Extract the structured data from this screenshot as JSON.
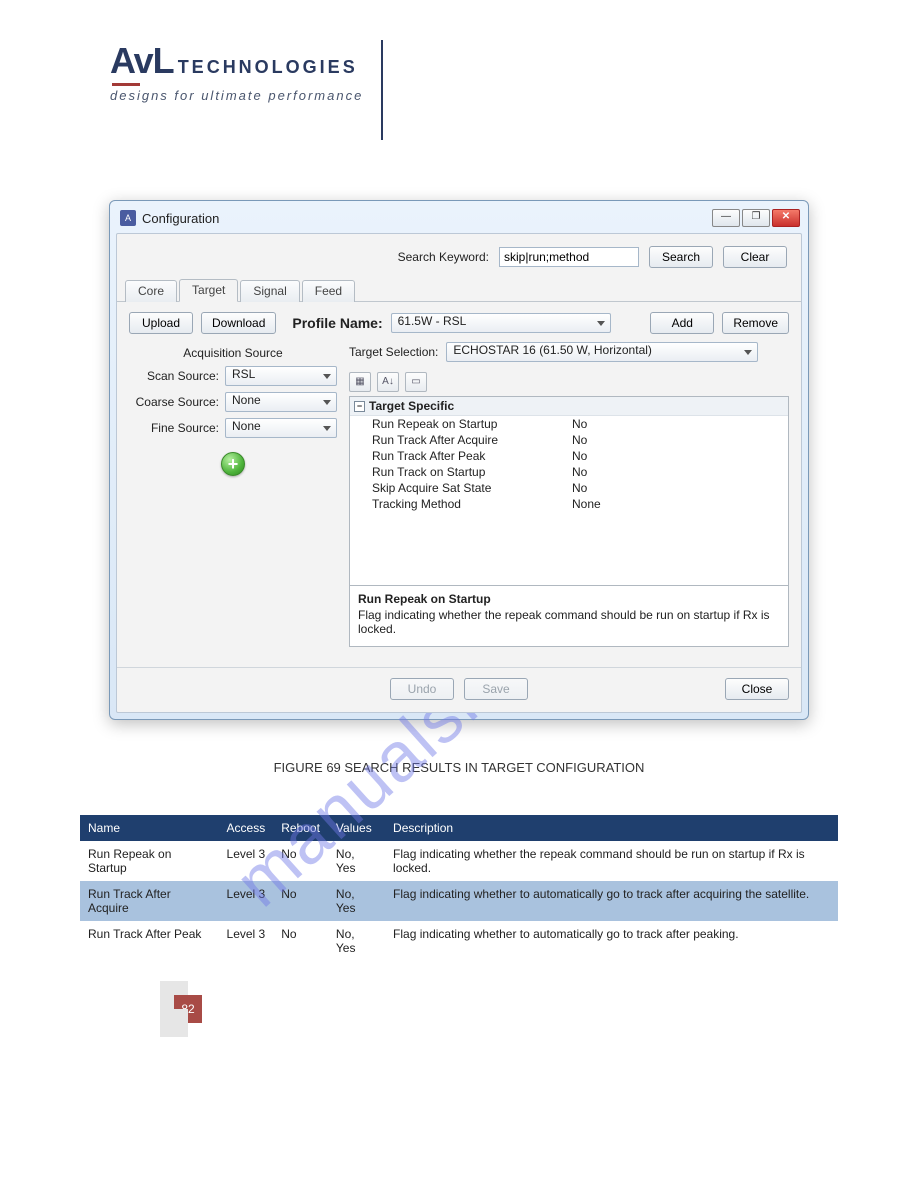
{
  "watermark": "manualshive.com",
  "header": {
    "logo_main": "AvL",
    "logo_secondary": "TECHNOLOGIES",
    "tagline": "designs for ultimate performance"
  },
  "window": {
    "title": "Configuration",
    "controls": {
      "minimize": "—",
      "maximize": "❐",
      "close": "✕"
    },
    "search": {
      "label": "Search Keyword:",
      "value": "skip|run;method",
      "search_btn": "Search",
      "clear_btn": "Clear"
    },
    "tabs": [
      {
        "label": "Core"
      },
      {
        "label": "Target"
      },
      {
        "label": "Signal"
      },
      {
        "label": "Feed"
      }
    ],
    "active_tab": "Target",
    "target_tab": {
      "upload_btn": "Upload",
      "download_btn": "Download",
      "profile_label": "Profile Name:",
      "profile_value": "61.5W - RSL",
      "add_btn": "Add",
      "remove_btn": "Remove",
      "acq_title": "Acquisition Source",
      "scan": {
        "label": "Scan Source:",
        "value": "RSL"
      },
      "coarse": {
        "label": "Coarse Source:",
        "value": "None"
      },
      "fine": {
        "label": "Fine Source:",
        "value": "None"
      },
      "target_sel_label": "Target Selection:",
      "target_sel_value": "ECHOSTAR 16 (61.50 W, Horizontal)",
      "group_name": "Target Specific",
      "rows": [
        {
          "key": "Run Repeak on Startup",
          "value": "No"
        },
        {
          "key": "Run Track After Acquire",
          "value": "No"
        },
        {
          "key": "Run Track After Peak",
          "value": "No"
        },
        {
          "key": "Run Track on Startup",
          "value": "No"
        },
        {
          "key": "Skip Acquire Sat State",
          "value": "No"
        },
        {
          "key": "Tracking Method",
          "value": "None"
        }
      ],
      "help": {
        "title": "Run Repeak on Startup",
        "text": "Flag indicating whether the repeak command should be run on startup if Rx is locked."
      }
    },
    "footer": {
      "undo": "Undo",
      "save": "Save",
      "close": "Close"
    }
  },
  "caption": "FIGURE 69 SEARCH RESULTS IN TARGET CONFIGURATION",
  "table": {
    "headers": [
      "Name",
      "Access",
      "Reboot",
      "Values",
      "Description"
    ],
    "rows": [
      {
        "name": "Run Repeak on Startup",
        "access": "Level 3",
        "reboot": "No",
        "values": "No, Yes",
        "desc": "Flag indicating whether the repeak command should be run on startup if Rx is locked."
      },
      {
        "name": "Run Track After Acquire",
        "access": "Level 3",
        "reboot": "No",
        "values": "No, Yes",
        "desc": "Flag indicating whether to automatically go to track after acquiring the satellite."
      },
      {
        "name": "Run Track After Peak",
        "access": "Level 3",
        "reboot": "No",
        "values": "No, Yes",
        "desc": "Flag indicating whether to automatically go to track after peaking."
      }
    ]
  },
  "page_number": "82"
}
